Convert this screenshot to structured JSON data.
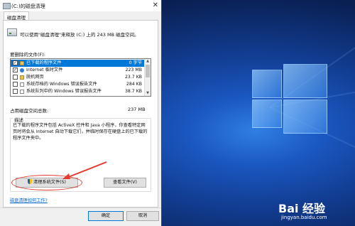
{
  "window": {
    "title": "(C:)的磁盘清理",
    "close": "✕"
  },
  "tab": {
    "label": "磁盘清理"
  },
  "summary": "可以使用\"磁盘清理\"来释放 (C:) 上的 243 MB 磁盘空间。",
  "files_to_delete_label": "要删除的文件(F):",
  "files": [
    {
      "name": "已下载的程序文件",
      "size": "0 字节",
      "checked": true,
      "selected": true,
      "icon": "folder-icon"
    },
    {
      "name": "Internet 临时文件",
      "size": "223 MB",
      "checked": true,
      "selected": false,
      "icon": "internet-icon"
    },
    {
      "name": "脱机网页",
      "size": "23.7 KB",
      "checked": false,
      "selected": false,
      "icon": "folder-icon"
    },
    {
      "name": "系统存档的 Windows 错误报告文件",
      "size": "284 KB",
      "checked": false,
      "selected": false,
      "icon": "file-icon"
    },
    {
      "name": "系统队列中的 Windows 错误报告文件",
      "size": "38.7 KB",
      "checked": false,
      "selected": false,
      "icon": "file-icon"
    }
  ],
  "space_gain_label": "占用磁盘空间总数:",
  "space_gain_value": "237 MB",
  "description_label": "描述",
  "description_text": "已下载的程序文件包括 ActiveX 控件和 Java 小程序，你查看特定网页时将会从 Internet 自动下载它们，并临时保存在硬盘上的已下载的程序文件夹中。",
  "buttons": {
    "cleanup_system": "清理系统文件(S)",
    "view_files": "查看文件(V)",
    "ok": "确定",
    "cancel": "取消"
  },
  "help_link": "磁盘清理如何工作?",
  "watermark": {
    "logo": "Bai 经验",
    "url": "jingyan.baidu.com"
  },
  "colors": {
    "selection": "#0078d7",
    "annotation": "#e23b2e",
    "desktop": "#123e94"
  }
}
